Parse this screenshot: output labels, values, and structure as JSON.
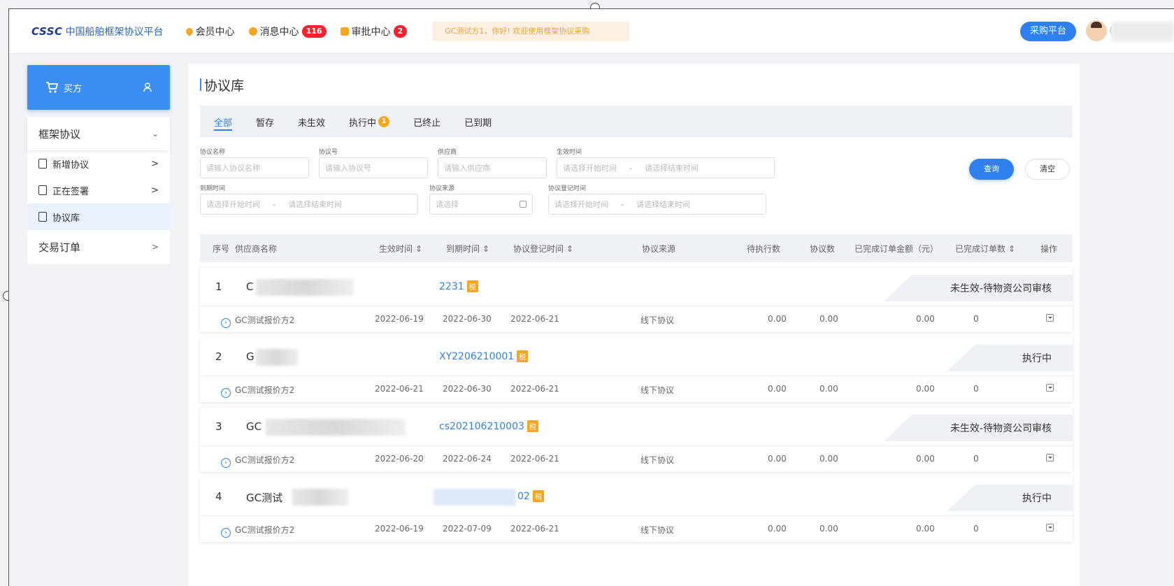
{
  "header": {
    "logo_mark": "CSSC",
    "logo_text": "中国船舶框架协议平台",
    "nav": [
      {
        "label": "会员中心",
        "icon_color": "#f5a623",
        "badge": ""
      },
      {
        "label": "消息中心",
        "icon_color": "#f5a623",
        "badge": "116"
      },
      {
        "label": "审批中心",
        "icon_color": "#f5a623",
        "badge": "2"
      }
    ],
    "notice": "GC测试方1，你好! 欢迎使用框架协议采购",
    "purchase_platform": "采购平台",
    "user_initial": "("
  },
  "sidebar": {
    "role_label": "买方",
    "groups": [
      {
        "label": "框架协议",
        "chevron": "⌄"
      },
      {
        "label": "交易订单",
        "chevron": ">"
      }
    ],
    "items": [
      {
        "label": "新增协议",
        "chevron": ">"
      },
      {
        "label": "正在签署",
        "chevron": ">"
      },
      {
        "label": "协议库",
        "chevron": ""
      }
    ]
  },
  "main": {
    "title": "协议库",
    "tabs": [
      {
        "label": "全部",
        "badge": ""
      },
      {
        "label": "暂存",
        "badge": ""
      },
      {
        "label": "未生效",
        "badge": ""
      },
      {
        "label": "执行中",
        "badge": "1"
      },
      {
        "label": "已终止",
        "badge": ""
      },
      {
        "label": "已到期",
        "badge": ""
      }
    ],
    "filters": {
      "name_label": "协议名称",
      "name_placeholder": "请输入协议名称",
      "code_label": "协议号",
      "code_placeholder": "请输入协议号",
      "supplier_label": "供应商",
      "supplier_placeholder": "请输入供应商",
      "effective_label": "生效时间",
      "effective_start": "请选择开始时间",
      "effective_end": "请选择结束时间",
      "expire_label": "到期时间",
      "expire_start": "请选择开始时间",
      "expire_end": "请选择结束时间",
      "source_label": "协议来源",
      "source_placeholder": "请选择",
      "register_label": "协议登记时间",
      "register_start": "请选择开始时间",
      "register_end": "请选择结束时间",
      "range_sep": "-",
      "query_button": "查询",
      "clear_button": "清空"
    },
    "columns": [
      "序号",
      "供应商名称",
      "生效时间 ⇕",
      "到期时间 ⇕",
      "协议登记时间 ⇕",
      "协议来源",
      "待执行数",
      "协议数",
      "已完成订单金额（元）",
      "已完成订单数 ⇕",
      "操作"
    ],
    "groups": [
      {
        "index": "1",
        "name": "C",
        "code": "2231",
        "tag": "税",
        "status": "未生效-待物资公司审核",
        "row": {
          "supplier": "GC测试报价方2",
          "effective": "2022-06-19",
          "expire": "2022-06-30",
          "register": "2022-06-21",
          "source": "线下协议",
          "pending": "0.00",
          "count": "0.00",
          "amount": "0.00",
          "orders": "0"
        }
      },
      {
        "index": "2",
        "name": "G",
        "code": "XY2206210001",
        "tag": "税",
        "status": "执行中",
        "row": {
          "supplier": "GC测试报价方2",
          "effective": "2022-06-21",
          "expire": "2022-06-30",
          "register": "2022-06-21",
          "source": "线下协议",
          "pending": "0.00",
          "count": "0.00",
          "amount": "0.00",
          "orders": "0"
        }
      },
      {
        "index": "3",
        "name": "GC",
        "code": "cs202106210003",
        "tag": "税",
        "status": "未生效-待物资公司审核",
        "row": {
          "supplier": "GC测试报价方2",
          "effective": "2022-06-20",
          "expire": "2022-06-24",
          "register": "2022-06-21",
          "source": "线下协议",
          "pending": "0.00",
          "count": "0.00",
          "amount": "0.00",
          "orders": "0"
        }
      },
      {
        "index": "4",
        "name": "GC测试",
        "code": "02",
        "tag": "税",
        "status": "执行中",
        "row": {
          "supplier": "GC测试报价方2",
          "effective": "2022-06-19",
          "expire": "2022-07-09",
          "register": "2022-06-21",
          "source": "线下协议",
          "pending": "0.00",
          "count": "0.00",
          "amount": "0.00",
          "orders": "0"
        }
      }
    ]
  }
}
